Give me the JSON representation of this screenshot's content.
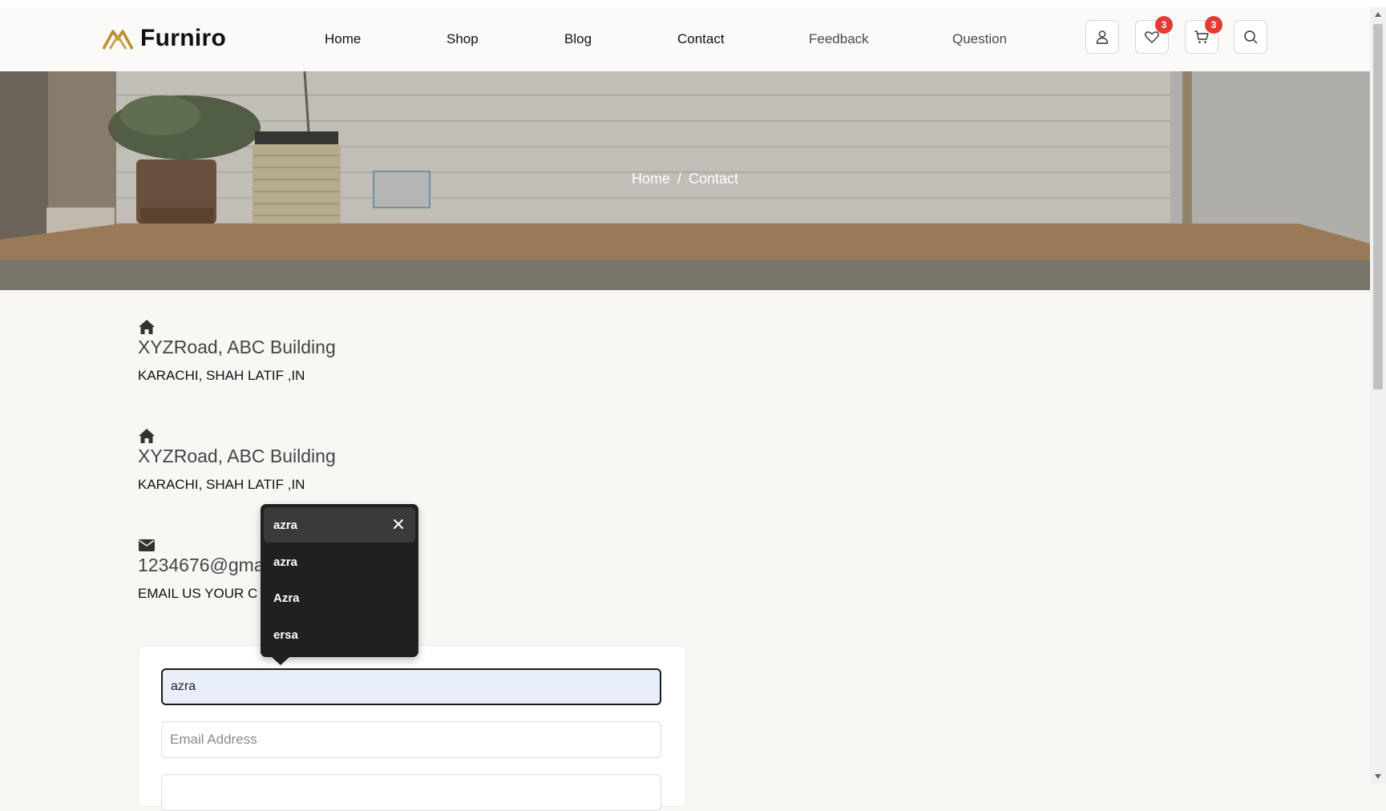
{
  "brand": {
    "name": "Furniro"
  },
  "nav": {
    "items": [
      {
        "label": "Home"
      },
      {
        "label": "Shop"
      },
      {
        "label": "Blog"
      },
      {
        "label": "Contact"
      },
      {
        "label": "Feedback"
      },
      {
        "label": "Question"
      }
    ]
  },
  "header_icons": {
    "account": "user-icon",
    "wishlist": "heart-icon",
    "wishlist_count": "3",
    "cart": "cart-icon",
    "cart_count": "3",
    "search": "search-icon"
  },
  "breadcrumb": {
    "home": "Home",
    "separator": "/",
    "current": "Contact"
  },
  "contact_info": [
    {
      "icon": "home-icon",
      "title": "XYZRoad, ABC Building",
      "subtitle": "KARACHI, SHAH LATIF ,IN"
    },
    {
      "icon": "home-icon",
      "title": "XYZRoad, ABC Building",
      "subtitle": "KARACHI, SHAH LATIF ,IN"
    },
    {
      "icon": "envelope-icon",
      "title": "1234676@gma",
      "subtitle": "EMAIL US YOUR C"
    }
  ],
  "form": {
    "name_value": "azra",
    "email_placeholder": "Email Address"
  },
  "autocomplete": {
    "items": [
      {
        "label": "azra",
        "selected": true
      },
      {
        "label": "azra",
        "selected": false
      },
      {
        "label": "Azra",
        "selected": false
      },
      {
        "label": "ersa",
        "selected": false
      }
    ]
  },
  "colors": {
    "badge": "#e53935",
    "logo_gold": "#b88e2f",
    "dropdown_bg": "#202020",
    "focused_field_bg": "#e8effb"
  }
}
